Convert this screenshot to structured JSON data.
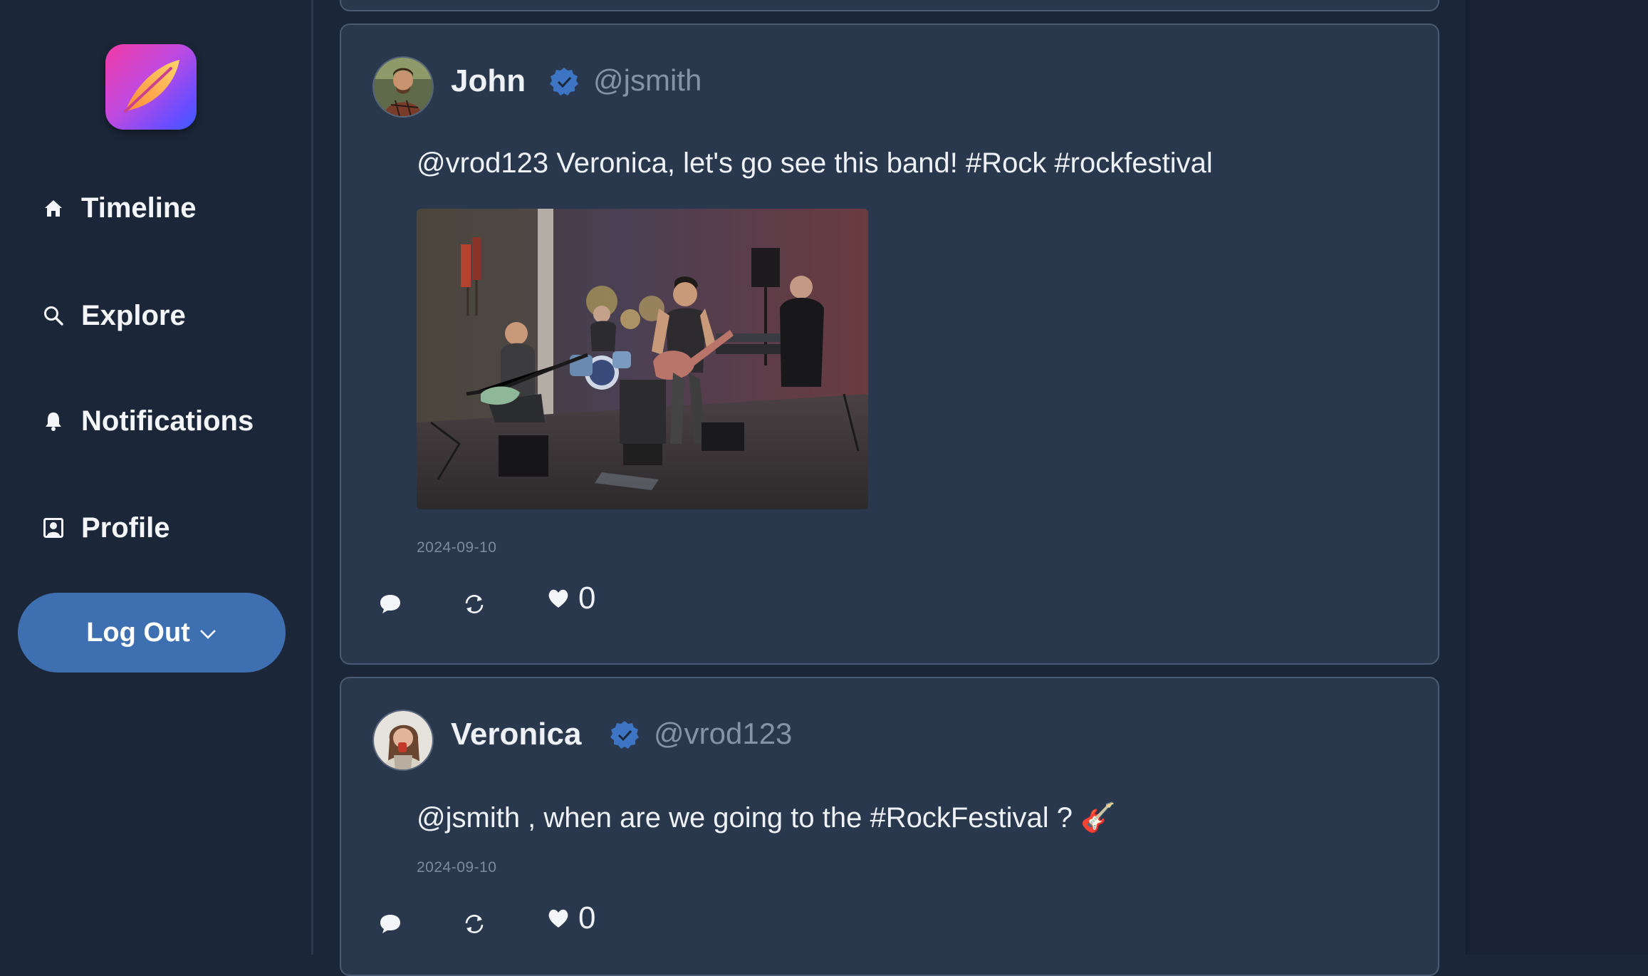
{
  "app": {
    "name": "Quill"
  },
  "nav": {
    "items": [
      {
        "label": "Timeline",
        "icon": "home-icon"
      },
      {
        "label": "Explore",
        "icon": "search-icon"
      },
      {
        "label": "Notifications",
        "icon": "bell-icon"
      },
      {
        "label": "Profile",
        "icon": "profile-icon"
      }
    ],
    "logout_label": "Log Out"
  },
  "posts": [
    {
      "author": "John",
      "handle": "@jsmith",
      "text": "@vrod123 Veronica, let's go see this band! #Rock #rockfestival",
      "has_image": true,
      "image_alt": "band playing on stage",
      "date": "2024-09-10",
      "likes": "0"
    },
    {
      "author": "Veronica",
      "handle": "@vrod123",
      "text": "@jsmith , when are we going to the #RockFestival ? 🎸",
      "has_image": false,
      "date": "2024-09-10",
      "likes": "0"
    }
  ],
  "colors": {
    "background": "#1b2739",
    "card": "#2a384d",
    "accent": "#3e6fb0",
    "verified": "#3e74c4",
    "muted": "#8593a8"
  }
}
